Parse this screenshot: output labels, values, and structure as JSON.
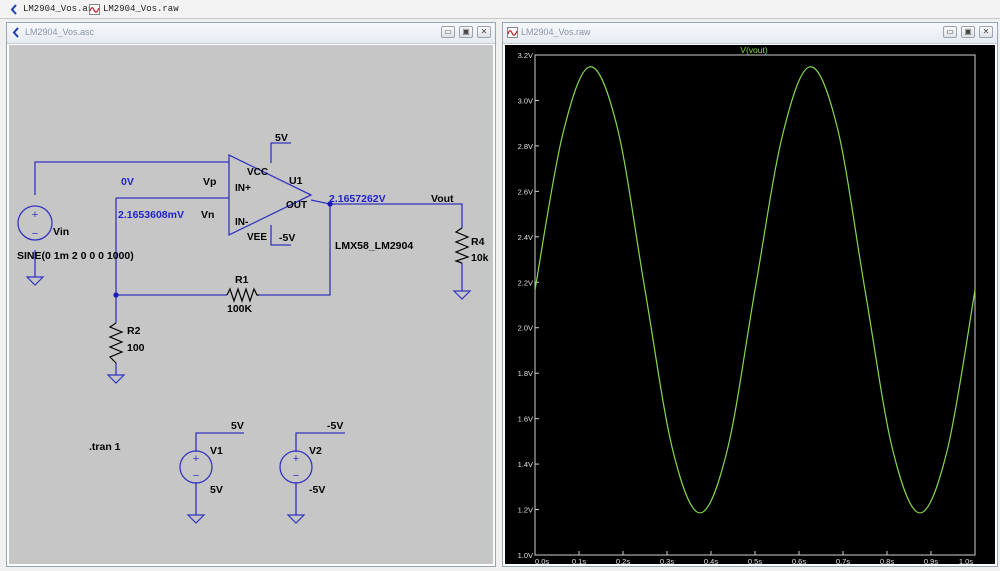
{
  "tabs": [
    {
      "label": "LM2904_Vos.asc",
      "icon": "schematic-icon"
    },
    {
      "label": "LM2904_Vos.raw",
      "icon": "waveform-icon"
    }
  ],
  "schematic_window": {
    "title": "LM2904_Vos.asc",
    "labels": {
      "vp_value": "0V",
      "vp_net": "Vp",
      "vn_value": "2.1653608mV",
      "vn_net": "Vn",
      "vout_value": "2.1657262V",
      "vout_net": "Vout",
      "u1": "U1",
      "vcc": "VCC",
      "vee": "VEE",
      "inp": "IN+",
      "inn": "IN-",
      "out": "OUT",
      "vcc_rail": "5V",
      "vee_rail": "-5V",
      "u1_model": "LMX58_LM2904",
      "vin": "Vin",
      "vin_value": "SINE(0 1m 2 0 0 0 1000)",
      "r1": "R1",
      "r1_value": "100K",
      "r2": "R2",
      "r2_value": "100",
      "r4": "R4",
      "r4_value": "10k",
      "tran": ".tran 1",
      "v1": "V1",
      "v1_value": "5V",
      "v1_net": "5V",
      "v2": "V2",
      "v2_value": "-5V",
      "v2_net": "-5V"
    },
    "colors": {
      "background": "#c6c6c6",
      "wire": "#3433c0",
      "text": "#000000",
      "net_label": "#2222cc"
    }
  },
  "plot_window": {
    "title": "LM2904_Vos.raw",
    "colors": {
      "background": "#000000",
      "trace": "#86d84a",
      "axis_text": "#e0e0e0",
      "grid": "#3a3a3a"
    }
  },
  "chart_data": {
    "type": "line",
    "title": "V(vout)",
    "xlabel": "",
    "ylabel": "",
    "xlim": [
      0.0,
      1.0
    ],
    "ylim": [
      1.0,
      3.2
    ],
    "x_ticks": [
      "0.0s",
      "0.1s",
      "0.2s",
      "0.3s",
      "0.4s",
      "0.5s",
      "0.6s",
      "0.7s",
      "0.8s",
      "0.9s",
      "1.0s"
    ],
    "y_ticks": [
      "1.0V",
      "1.2V",
      "1.4V",
      "1.6V",
      "1.8V",
      "2.0V",
      "2.2V",
      "2.4V",
      "2.6V",
      "2.8V",
      "3.0V",
      "3.2V"
    ],
    "series": [
      {
        "name": "V(vout)",
        "x": [
          0.0,
          0.0625,
          0.125,
          0.1875,
          0.25,
          0.3125,
          0.375,
          0.4375,
          0.5,
          0.5625,
          0.625,
          0.6875,
          0.75,
          0.8125,
          0.875,
          0.9375,
          1.0
        ],
        "y": [
          2.166,
          2.847,
          3.148,
          2.877,
          2.166,
          1.466,
          1.185,
          1.466,
          2.166,
          2.847,
          3.148,
          2.877,
          2.166,
          1.466,
          1.185,
          1.466,
          2.166
        ]
      }
    ],
    "grid": false
  }
}
